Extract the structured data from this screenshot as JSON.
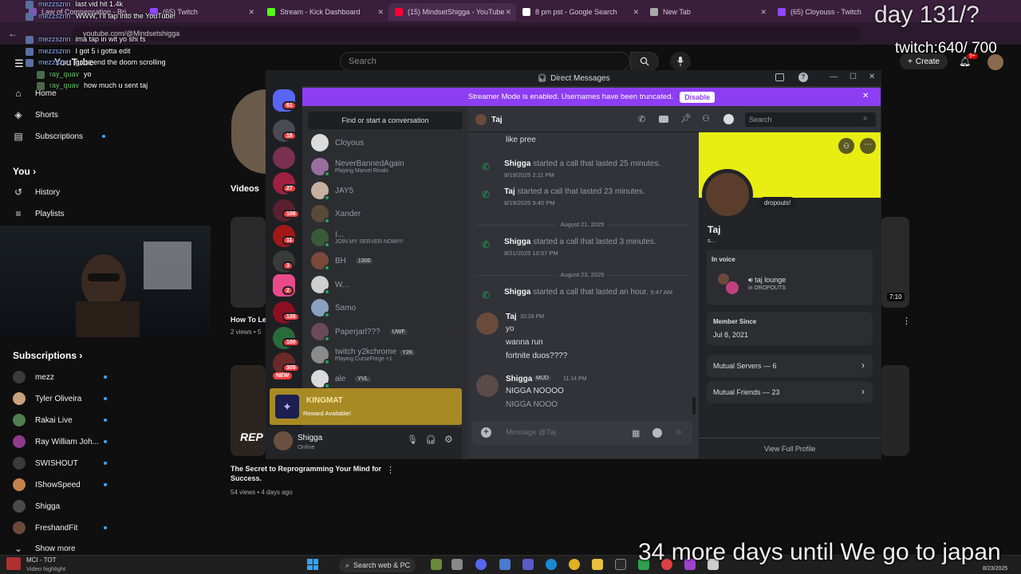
{
  "browser": {
    "tabs": [
      {
        "label": "Law of Compensation - Bri...",
        "color": "#7a5ab5"
      },
      {
        "label": "(65) Twitch",
        "color": "#9146ff"
      },
      {
        "label": "Stream - Kick Dashboard",
        "color": "#53fc18"
      },
      {
        "label": "(15) MindsetShigga - YouTube",
        "color": "#ff0033"
      },
      {
        "label": "8 pm pst - Google Search",
        "color": "#ffffff"
      },
      {
        "label": "New Tab",
        "color": "#aaaaaa"
      },
      {
        "label": "(65) Cloyouss - Twitch",
        "color": "#9146ff"
      }
    ],
    "url": "youtube.com/@Mindsetshigga"
  },
  "chat_overlay": [
    {
      "user": "mezzsznn",
      "msg": "last vid hit 1.4k"
    },
    {
      "user": "mezzsznn",
      "msg": "WWW, I'll tap into the YouTube!"
    },
    {
      "user": "mezzsznn",
      "msg": "ima tap in wit yo shi fs"
    },
    {
      "user": "mezzsznn",
      "msg": "I got 5 i gotta edit"
    },
    {
      "user": "mezzsznn",
      "msg": "gotta end the doom scrolling"
    },
    {
      "user": "ray_quav",
      "msg": "yo"
    },
    {
      "user": "ray_quav",
      "msg": "how much u sent taj"
    }
  ],
  "overlay": {
    "day": "day 131/?",
    "twitch": "twitch:640/ 700",
    "japan": "34 more days until We go to japan"
  },
  "youtube": {
    "logo": "YouTube",
    "search_placeholder": "Search",
    "create": "Create",
    "notif_count": "9+",
    "nav": [
      "Home",
      "Shorts",
      "Subscriptions"
    ],
    "you_label": "You",
    "you_items": [
      "History",
      "Playlists"
    ],
    "subs_label": "Subscriptions",
    "subs": [
      {
        "name": "mezz",
        "color": "#3a3a3a"
      },
      {
        "name": "Tyler Oliveira",
        "color": "#c9a27e"
      },
      {
        "name": "Rakai Live",
        "color": "#4f7f4f"
      },
      {
        "name": "Ray William Joh...",
        "color": "#8f3a8a"
      },
      {
        "name": "SWISHOUT",
        "color": "#3a3a3a"
      },
      {
        "name": "IShowSpeed",
        "color": "#c4824a"
      },
      {
        "name": "Shigga",
        "color": "#4a4a4a"
      },
      {
        "name": "FreshandFit",
        "color": "#6b4a3a"
      }
    ],
    "show_more": "Show more",
    "videos_tab": "Videos",
    "video1": {
      "title": "How To Le",
      "meta": "2 views • 5"
    },
    "video2": {
      "title": "The Secret to Reprogramming Your Mind for Success.",
      "meta": "54 views • 4 days ago",
      "thumb_text": "REP"
    },
    "duration": "7:10"
  },
  "discord": {
    "window_title": "Direct Messages",
    "streamer_mode": "Streamer Mode is enabled. Usernames have been truncated.",
    "disable": "Disable",
    "guild_badges": [
      "61",
      "18",
      "27",
      "106",
      "11",
      "3",
      "2",
      "135",
      "100",
      "305",
      "NEW"
    ],
    "find": "Find or start a conversation",
    "dms": [
      {
        "name": "Cloyous",
        "sub": "",
        "tag": "",
        "color": "#dcdcdc"
      },
      {
        "name": "NeverBannedAgain",
        "sub": "Playing Marvel Rivals",
        "tag": "",
        "color": "#9a6fa0"
      },
      {
        "name": "JAY5",
        "sub": "",
        "tag": "",
        "color": "#c8b0a0"
      },
      {
        "name": "Xander",
        "sub": "",
        "tag": "",
        "color": "#5a4a3a"
      },
      {
        "name": "I...",
        "sub": "JOIN MY SERVER NOW!!!!",
        "tag": "",
        "color": "#3a5a3a"
      },
      {
        "name": "BH",
        "sub": "",
        "tag": "1300",
        "color": "#7a4a3a"
      },
      {
        "name": "W...",
        "sub": "",
        "tag": "",
        "color": "#cfcfcf"
      },
      {
        "name": "Samo",
        "sub": "",
        "tag": "",
        "color": "#8aa0c0"
      },
      {
        "name": "Paperjarl???",
        "sub": "",
        "tag": "UWF",
        "color": "#6a4a5a"
      },
      {
        "name": "twitch y2kchrome",
        "sub": "Playing CurseForge +1",
        "tag": "Y2K",
        "color": "#8a8a8a"
      },
      {
        "name": "ale",
        "sub": "",
        "tag": "YVL",
        "color": "#dadada"
      }
    ],
    "promo": {
      "title": "KINGMAT",
      "sub": "Reward Available!"
    },
    "me": {
      "name": "Shigga",
      "status": "Online"
    },
    "chat_header": "Taj",
    "chat_search": "Search",
    "messages": {
      "like_pree": "like pree",
      "call1": {
        "who": "Shigga",
        "text": "started a call that lasted 25 minutes.",
        "date": "8/19/2025 2:11 PM"
      },
      "call2": {
        "who": "Taj",
        "text": "started a call that lasted 23 minutes.",
        "date": "8/19/2025 9:40 PM"
      },
      "sep1": "August 21, 2025",
      "call3": {
        "who": "Shigga",
        "text": "started a call that lasted 3 minutes.",
        "date": "8/21/2025 10:57 PM"
      },
      "sep2": "August 23, 2025",
      "call4": {
        "who": "Shigga",
        "text": "started a call that lasted an hour.",
        "date": "5:47 AM"
      },
      "taj_name": "Taj",
      "taj_time": "10:28 PM",
      "taj_lines": [
        "yo",
        "wanna run",
        "fortnite duos????"
      ],
      "shigga_name": "Shigga",
      "shigga_tag": "MUD",
      "shigga_time": "11:14 PM",
      "shigga_lines": [
        "NIGGA NOOOO",
        "NIGGA NOOO"
      ]
    },
    "composer_placeholder": "Message @Taj",
    "profile": {
      "status": "dropouts!",
      "name": "Taj",
      "sub": "s...",
      "in_voice": "In voice",
      "voice_channel": "taj lounge",
      "voice_server": "in DROPOUTS",
      "member_since_label": "Member Since",
      "member_since": "Jul 8, 2021",
      "mutual_servers": "Mutual Servers — 6",
      "mutual_friends": "Mutual Friends — 23",
      "view_full": "View Full Profile"
    }
  },
  "taskbar": {
    "media_title": "MCI - TOT",
    "media_sub": "Video highlight",
    "search": "Search web & PC",
    "date": "8/23/2025"
  }
}
